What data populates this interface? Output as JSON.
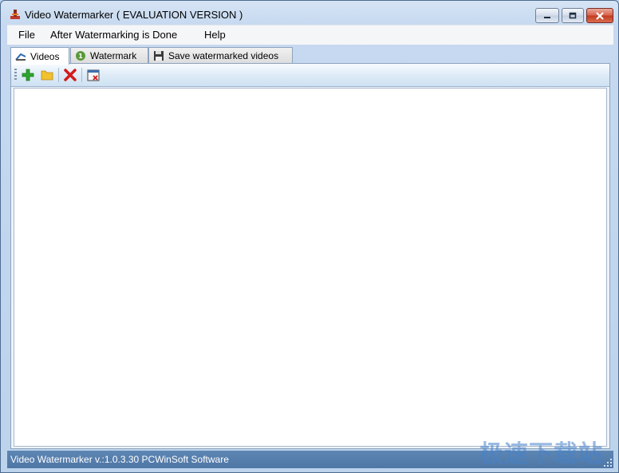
{
  "window": {
    "title": "Video Watermarker ( EVALUATION VERSION )"
  },
  "menu": {
    "file": "File",
    "after": "After Watermarking is Done",
    "help": "Help"
  },
  "tabs": [
    {
      "label": "Videos",
      "icon": "video-icon"
    },
    {
      "label": "Watermark",
      "icon": "watermark-badge-icon"
    },
    {
      "label": "Save watermarked videos",
      "icon": "floppy-disk-icon"
    }
  ],
  "toolbar": {
    "buttons": [
      "add-icon",
      "folder-icon",
      "remove-icon",
      "clear-list-icon"
    ]
  },
  "status": {
    "text": "Video Watermarker v.:1.0.3.30 PCWinSoft Software"
  },
  "overlay": {
    "watermark_text": "极速下载站"
  },
  "colors": {
    "statusbar": "#5580b0",
    "accent_close": "#c23a1f",
    "add": "#2ea52e",
    "remove": "#d21b1b",
    "folder": "#f2c12e"
  }
}
